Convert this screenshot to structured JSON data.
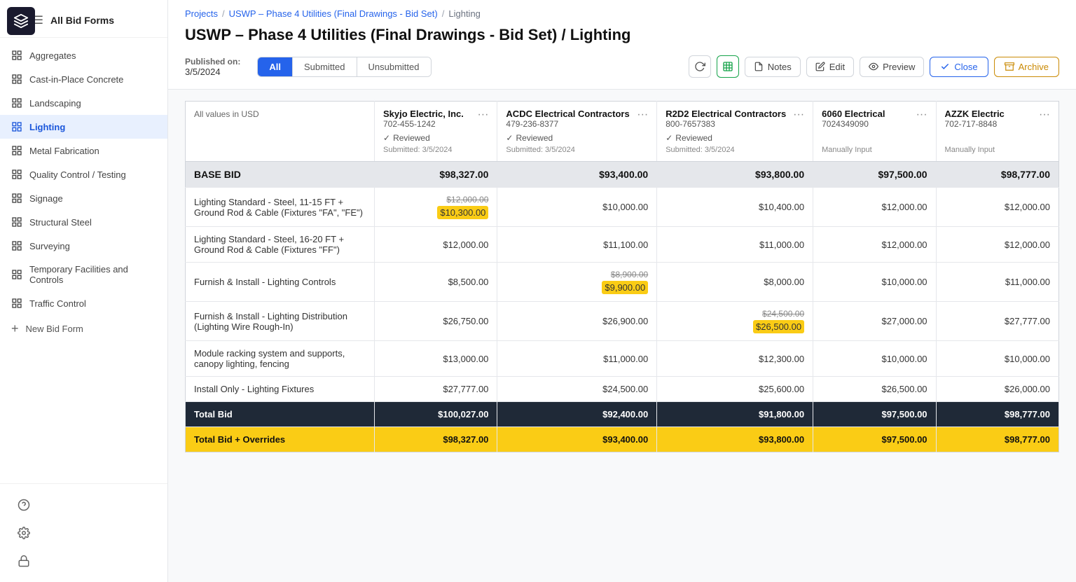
{
  "sidebar": {
    "all_bid_forms": "All Bid Forms",
    "nav_items": [
      {
        "id": "aggregates",
        "label": "Aggregates",
        "active": false
      },
      {
        "id": "cast-in-place",
        "label": "Cast-in-Place Concrete",
        "active": false
      },
      {
        "id": "landscaping",
        "label": "Landscaping",
        "active": false
      },
      {
        "id": "lighting",
        "label": "Lighting",
        "active": true
      },
      {
        "id": "metal-fabrication",
        "label": "Metal Fabrication",
        "active": false
      },
      {
        "id": "quality-control",
        "label": "Quality Control / Testing",
        "active": false
      },
      {
        "id": "signage",
        "label": "Signage",
        "active": false
      },
      {
        "id": "structural-steel",
        "label": "Structural Steel",
        "active": false
      },
      {
        "id": "surveying",
        "label": "Surveying",
        "active": false
      },
      {
        "id": "temp-facilities",
        "label": "Temporary Facilities and Controls",
        "active": false
      },
      {
        "id": "traffic-control",
        "label": "Traffic Control",
        "active": false
      }
    ],
    "add_new": "New Bid Form"
  },
  "breadcrumb": {
    "projects": "Projects",
    "project": "USWP – Phase 4 Utilities (Final Drawings - Bid Set)",
    "current": "Lighting"
  },
  "page_title": "USWP – Phase 4 Utilities (Final Drawings - Bid Set) / Lighting",
  "published": {
    "label": "Published on:",
    "date": "3/5/2024"
  },
  "filter_tabs": [
    {
      "label": "All",
      "active": true
    },
    {
      "label": "Submitted",
      "active": false
    },
    {
      "label": "Unsubmitted",
      "active": false
    }
  ],
  "actions": {
    "refresh": "↻",
    "export": "export",
    "notes": "Notes",
    "edit": "Edit",
    "preview": "Preview",
    "close": "Close",
    "archive": "Archive"
  },
  "table": {
    "usd_note": "All values in USD",
    "vendors": [
      {
        "name": "Skyjo Electric, Inc.",
        "phone": "702-455-1242",
        "reviewed": "Reviewed",
        "submitted": "Submitted: 3/5/2024",
        "manual": false
      },
      {
        "name": "ACDC Electrical Contractors",
        "phone": "479-236-8377",
        "reviewed": "Reviewed",
        "submitted": "Submitted: 3/5/2024",
        "manual": false
      },
      {
        "name": "R2D2 Electrical Contractors",
        "phone": "800-7657383",
        "reviewed": "Reviewed",
        "submitted": "Submitted: 3/5/2024",
        "manual": false
      },
      {
        "name": "6060 Electrical",
        "phone": "7024349090",
        "reviewed": null,
        "submitted": null,
        "manual": "Manually Input"
      },
      {
        "name": "AZZK Electric",
        "phone": "702-717-8848",
        "reviewed": null,
        "submitted": null,
        "manual": "Manually Input"
      }
    ],
    "base_bid": {
      "label": "BASE BID",
      "values": [
        "$98,327.00",
        "$93,400.00",
        "$93,800.00",
        "$97,500.00",
        "$98,777.00"
      ]
    },
    "line_items": [
      {
        "label": "Lighting Standard - Steel, 11-15 FT + Ground Rod & Cable (Fixtures \"FA\", \"FE\")",
        "values": [
          {
            "amount": "$10,300.00",
            "strikethrough": "$12,000.00",
            "highlight": true
          },
          {
            "amount": "$10,000.00",
            "strikethrough": null,
            "highlight": false
          },
          {
            "amount": "$10,400.00",
            "strikethrough": null,
            "highlight": false
          },
          {
            "amount": "$12,000.00",
            "strikethrough": null,
            "highlight": false
          },
          {
            "amount": "$12,000.00",
            "strikethrough": null,
            "highlight": false
          }
        ]
      },
      {
        "label": "Lighting Standard - Steel, 16-20 FT + Ground Rod & Cable (Fixtures \"FF\")",
        "values": [
          {
            "amount": "$12,000.00",
            "strikethrough": null,
            "highlight": false
          },
          {
            "amount": "$11,100.00",
            "strikethrough": null,
            "highlight": false
          },
          {
            "amount": "$11,000.00",
            "strikethrough": null,
            "highlight": false
          },
          {
            "amount": "$12,000.00",
            "strikethrough": null,
            "highlight": false
          },
          {
            "amount": "$12,000.00",
            "strikethrough": null,
            "highlight": false
          }
        ]
      },
      {
        "label": "Furnish & Install - Lighting Controls",
        "values": [
          {
            "amount": "$8,500.00",
            "strikethrough": null,
            "highlight": false
          },
          {
            "amount": "$9,900.00",
            "strikethrough": "$8,900.00",
            "highlight": true
          },
          {
            "amount": "$8,000.00",
            "strikethrough": null,
            "highlight": false
          },
          {
            "amount": "$10,000.00",
            "strikethrough": null,
            "highlight": false
          },
          {
            "amount": "$11,000.00",
            "strikethrough": null,
            "highlight": false
          }
        ]
      },
      {
        "label": "Furnish & Install - Lighting Distribution (Lighting Wire Rough-In)",
        "values": [
          {
            "amount": "$26,750.00",
            "strikethrough": null,
            "highlight": false
          },
          {
            "amount": "$26,900.00",
            "strikethrough": null,
            "highlight": false
          },
          {
            "amount": "$26,500.00",
            "strikethrough": "$24,500.00",
            "highlight": true
          },
          {
            "amount": "$27,000.00",
            "strikethrough": null,
            "highlight": false
          },
          {
            "amount": "$27,777.00",
            "strikethrough": null,
            "highlight": false
          }
        ]
      },
      {
        "label": "Module racking system and supports, canopy lighting, fencing",
        "values": [
          {
            "amount": "$13,000.00",
            "strikethrough": null,
            "highlight": false
          },
          {
            "amount": "$11,000.00",
            "strikethrough": null,
            "highlight": false
          },
          {
            "amount": "$12,300.00",
            "strikethrough": null,
            "highlight": false
          },
          {
            "amount": "$10,000.00",
            "strikethrough": null,
            "highlight": false
          },
          {
            "amount": "$10,000.00",
            "strikethrough": null,
            "highlight": false
          }
        ]
      },
      {
        "label": "Install Only - Lighting Fixtures",
        "values": [
          {
            "amount": "$27,777.00",
            "strikethrough": null,
            "highlight": false
          },
          {
            "amount": "$24,500.00",
            "strikethrough": null,
            "highlight": false
          },
          {
            "amount": "$25,600.00",
            "strikethrough": null,
            "highlight": false
          },
          {
            "amount": "$26,500.00",
            "strikethrough": null,
            "highlight": false
          },
          {
            "amount": "$26,000.00",
            "strikethrough": null,
            "highlight": false
          }
        ]
      }
    ],
    "total_bid": {
      "label": "Total Bid",
      "values": [
        "$100,027.00",
        "$92,400.00",
        "$91,800.00",
        "$97,500.00",
        "$98,777.00"
      ]
    },
    "total_overrides": {
      "label": "Total Bid + Overrides",
      "values": [
        "$98,327.00",
        "$93,400.00",
        "$93,800.00",
        "$97,500.00",
        "$98,777.00"
      ]
    }
  }
}
